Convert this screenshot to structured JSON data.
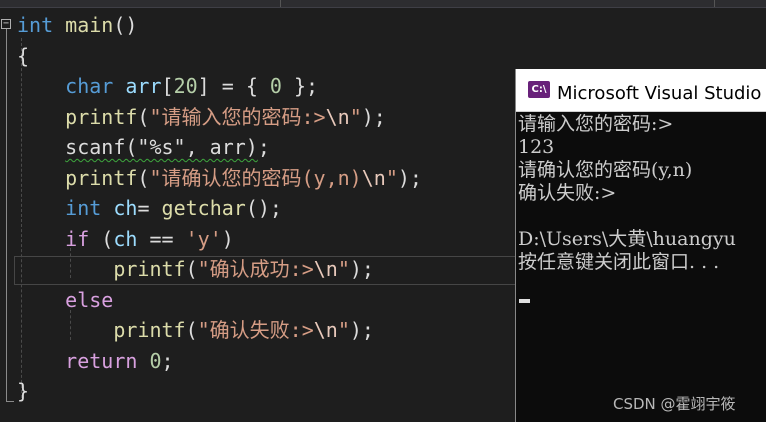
{
  "editor": {
    "lines": [
      [
        {
          "t": "int",
          "c": "kw"
        },
        {
          "t": " main",
          "c": "fn"
        },
        {
          "t": "()",
          "c": "p"
        }
      ],
      [
        {
          "t": "{",
          "c": "p"
        }
      ],
      [
        {
          "t": "    ",
          "c": "p"
        },
        {
          "t": "char",
          "c": "kw"
        },
        {
          "t": " ",
          "c": "p"
        },
        {
          "t": "arr",
          "c": "id"
        },
        {
          "t": "[",
          "c": "p"
        },
        {
          "t": "20",
          "c": "num"
        },
        {
          "t": "] = { ",
          "c": "p"
        },
        {
          "t": "0",
          "c": "num"
        },
        {
          "t": " };",
          "c": "p"
        }
      ],
      [
        {
          "t": "    ",
          "c": "p"
        },
        {
          "t": "printf",
          "c": "fn"
        },
        {
          "t": "(",
          "c": "p"
        },
        {
          "t": "\"请输入您的密码:>",
          "c": "str"
        },
        {
          "t": "\\n",
          "c": "esc"
        },
        {
          "t": "\"",
          "c": "str"
        },
        {
          "t": ");",
          "c": "p"
        }
      ],
      [
        {
          "t": "    ",
          "c": "p"
        },
        {
          "t": "scanf(\"%s\", arr)",
          "c": "squig"
        },
        {
          "t": ";",
          "c": "p"
        }
      ],
      [
        {
          "t": "    ",
          "c": "p"
        },
        {
          "t": "printf",
          "c": "fn"
        },
        {
          "t": "(",
          "c": "p"
        },
        {
          "t": "\"请确认您的密码(y,n)",
          "c": "str"
        },
        {
          "t": "\\n",
          "c": "esc"
        },
        {
          "t": "\"",
          "c": "str"
        },
        {
          "t": ");",
          "c": "p"
        }
      ],
      [
        {
          "t": "    ",
          "c": "p"
        },
        {
          "t": "int",
          "c": "kw"
        },
        {
          "t": " ",
          "c": "p"
        },
        {
          "t": "ch",
          "c": "id"
        },
        {
          "t": "= ",
          "c": "p"
        },
        {
          "t": "getchar",
          "c": "fn"
        },
        {
          "t": "();",
          "c": "p"
        }
      ],
      [
        {
          "t": "    ",
          "c": "p"
        },
        {
          "t": "if",
          "c": "kw2"
        },
        {
          "t": " (",
          "c": "p"
        },
        {
          "t": "ch",
          "c": "id"
        },
        {
          "t": " == ",
          "c": "p"
        },
        {
          "t": "'y'",
          "c": "str"
        },
        {
          "t": ")",
          "c": "p"
        }
      ],
      [
        {
          "t": "        ",
          "c": "p"
        },
        {
          "t": "printf",
          "c": "fn"
        },
        {
          "t": "(",
          "c": "p"
        },
        {
          "t": "\"确认成功:>",
          "c": "str"
        },
        {
          "t": "\\n",
          "c": "esc"
        },
        {
          "t": "\"",
          "c": "str"
        },
        {
          "t": ");",
          "c": "p"
        }
      ],
      [
        {
          "t": "    ",
          "c": "p"
        },
        {
          "t": "else",
          "c": "kw2"
        }
      ],
      [
        {
          "t": "        ",
          "c": "p"
        },
        {
          "t": "printf",
          "c": "fn"
        },
        {
          "t": "(",
          "c": "p"
        },
        {
          "t": "\"确认失败:>",
          "c": "str"
        },
        {
          "t": "\\n",
          "c": "esc"
        },
        {
          "t": "\"",
          "c": "str"
        },
        {
          "t": ");",
          "c": "p"
        }
      ],
      [
        {
          "t": "    ",
          "c": "p"
        },
        {
          "t": "return",
          "c": "kw2"
        },
        {
          "t": " ",
          "c": "p"
        },
        {
          "t": "0",
          "c": "num"
        },
        {
          "t": ";",
          "c": "p"
        }
      ],
      [
        {
          "t": "}",
          "c": "p"
        }
      ]
    ]
  },
  "console": {
    "icon_label": "C:\\",
    "title": "Microsoft Visual Studio 调",
    "output": [
      "请输入您的密码:>",
      "123",
      "请确认您的密码(y,n)",
      "确认失败:>",
      "",
      "D:\\Users\\大黄\\huangyu",
      "按任意键关闭此窗口. . ."
    ]
  },
  "watermark": "CSDN @霍翊宇筱",
  "colors": {
    "editor_bg": "#1e1e1e",
    "keyword": "#569cd6",
    "control_keyword": "#d8a0df",
    "function": "#dcdcaa",
    "string": "#d69d85",
    "identifier": "#9cdcfe",
    "number": "#b5cea8",
    "console_bg": "#0c0c0c"
  }
}
